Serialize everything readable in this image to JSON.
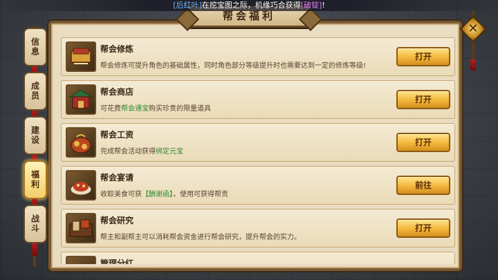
{
  "announcement": {
    "tag": "[后红叶]",
    "message": "在挖宝图之际，机缘巧合获得",
    "item": "[破锭]",
    "suffix": "!"
  },
  "panel": {
    "title": "帮会福利"
  },
  "tabs": [
    {
      "label": "信息",
      "active": false
    },
    {
      "label": "成员",
      "active": false
    },
    {
      "label": "建设",
      "active": false
    },
    {
      "label": "福利",
      "active": true
    },
    {
      "label": "战斗",
      "active": false
    }
  ],
  "rows": [
    {
      "title": "帮会修炼",
      "desc": "帮会修炼可提升角色的基础属性，同时角色部分等级提升时也需要达到一定的修炼等级!",
      "button": "打开",
      "icon": "cultivation-book-icon"
    },
    {
      "title": "帮会商店",
      "desc_pre": "可花费",
      "desc_hl": "帮会通宝",
      "desc_post": "购买珍贵的限量道具",
      "button": "打开",
      "icon": "shop-building-icon"
    },
    {
      "title": "帮会工资",
      "desc_pre": "完成帮会活动获得",
      "desc_hl": "绑定元宝",
      "desc_post": "",
      "button": "打开",
      "icon": "money-pouch-icon"
    },
    {
      "title": "帮会宴请",
      "desc_pre": "收取美食可获",
      "desc_hl": "【酬谢函】",
      "desc_post": "，使用可获得帮贡",
      "button": "前往",
      "icon": "banquet-dish-icon"
    },
    {
      "title": "帮会研究",
      "desc": "帮主和副帮主可以消耗帮会资金进行帮会研究，提升帮会的实力。",
      "button": "打开",
      "icon": "research-books-icon"
    }
  ],
  "partial_row": {
    "title": "管理分红"
  },
  "close": {
    "label": "✕"
  }
}
